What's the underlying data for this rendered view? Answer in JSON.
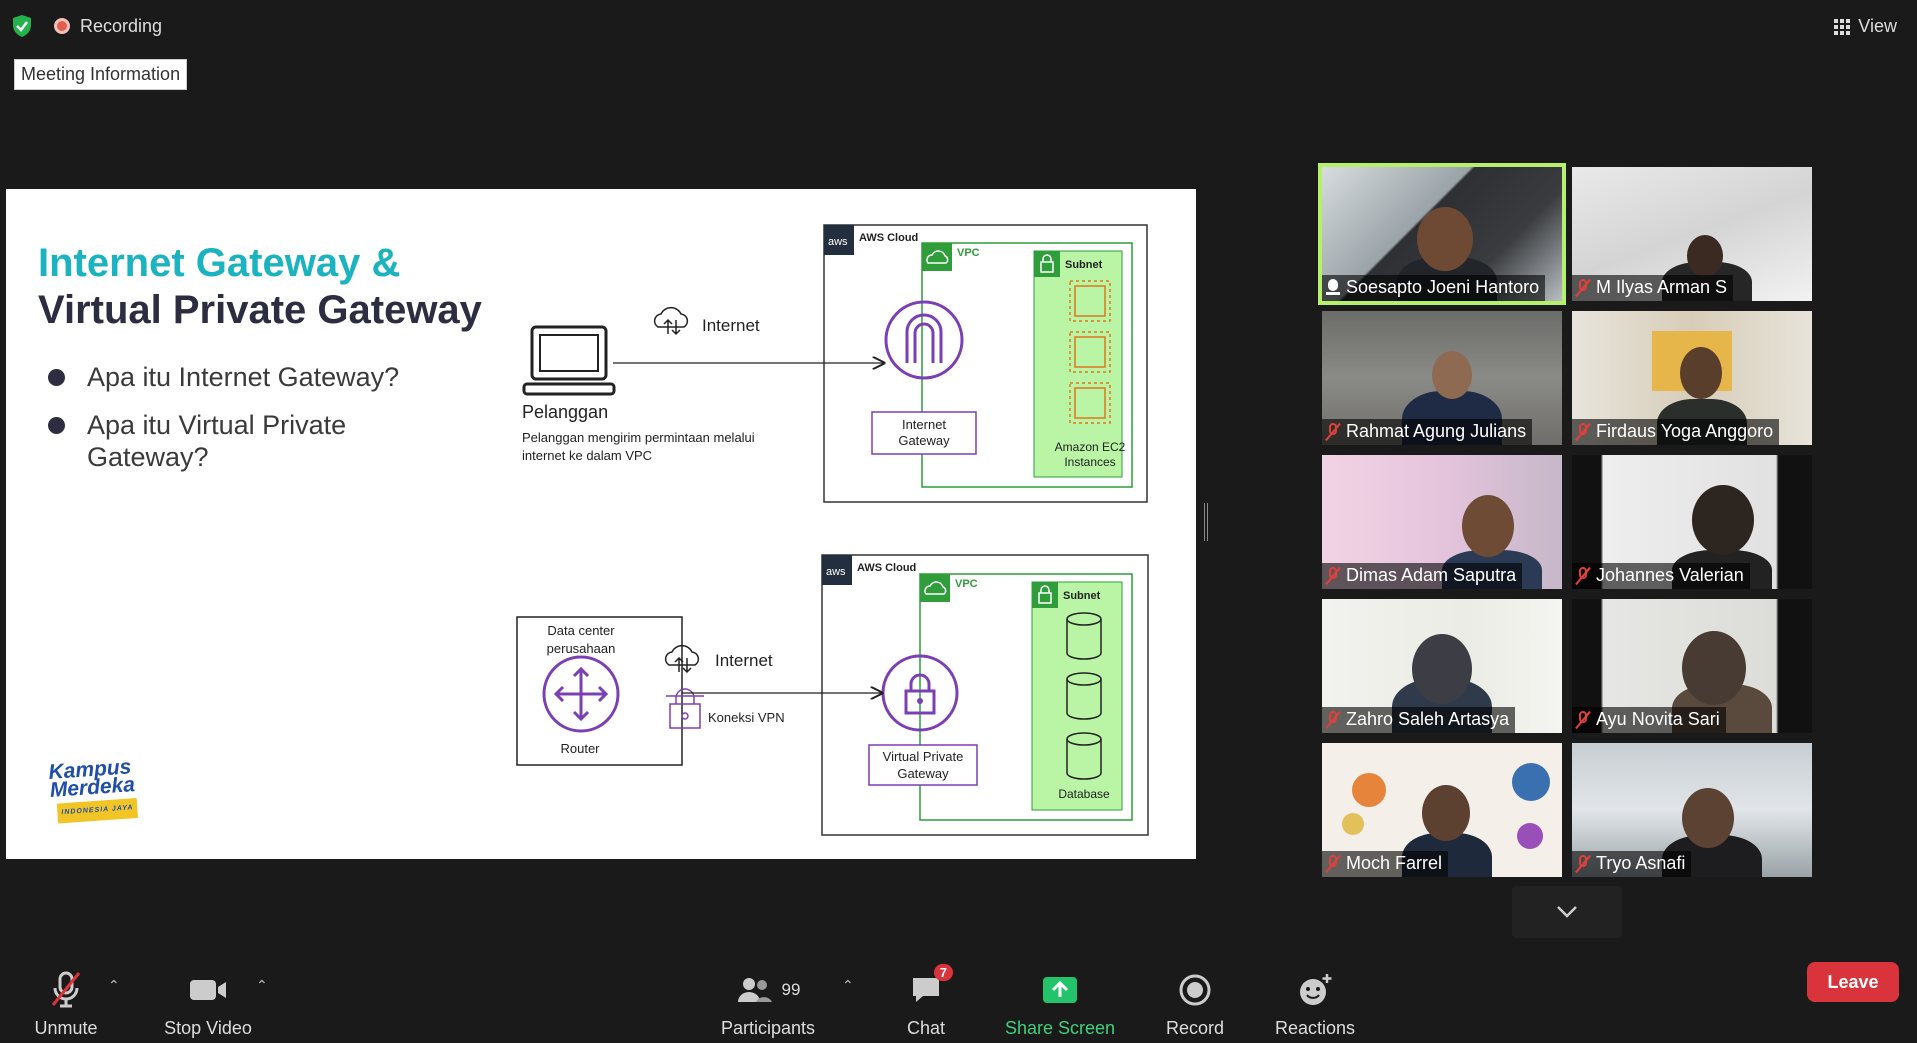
{
  "top": {
    "recording_label": "Recording",
    "meeting_info_label": "Meeting Information",
    "view_label": "View"
  },
  "slide": {
    "title_line1": "Internet Gateway &",
    "title_line2": "Virtual Private Gateway",
    "bullets": [
      "Apa itu Internet Gateway?",
      "Apa itu Virtual Private Gateway?"
    ],
    "top_diagram": {
      "aws_logo": "aws",
      "cloud_label": "AWS Cloud",
      "vpc_label": "VPC",
      "subnet_label": "Subnet",
      "internet_label": "Internet",
      "customer_label": "Pelanggan",
      "customer_desc_line1": "Pelanggan mengirim permintaan melalui",
      "customer_desc_line2": "internet ke dalam VPC",
      "gateway_line1": "Internet",
      "gateway_line2": "Gateway",
      "ec2_line1": "Amazon EC2",
      "ec2_line2": "Instances"
    },
    "bottom_diagram": {
      "aws_logo": "aws",
      "cloud_label": "AWS Cloud",
      "vpc_label": "VPC",
      "subnet_label": "Subnet",
      "datacenter_line1": "Data center",
      "datacenter_line2": "perusahaan",
      "router_label": "Router",
      "internet_label": "Internet",
      "vpn_label": "Koneksi VPN",
      "vpg_line1": "Virtual Private",
      "vpg_line2": "Gateway",
      "database_label": "Database"
    },
    "logo_line1": "Kampus",
    "logo_line2": "Merdeka",
    "logo_sub": "INDONESIA JAYA"
  },
  "participants": [
    {
      "name": "Soesapto Joeni Hantoro",
      "muted": false,
      "active": true
    },
    {
      "name": "M Ilyas Arman S",
      "muted": true
    },
    {
      "name": "Rahmat Agung Julians",
      "muted": true
    },
    {
      "name": "Firdaus Yoga Anggoro",
      "muted": true
    },
    {
      "name": "Dimas Adam Saputra",
      "muted": true
    },
    {
      "name": "Johannes Valerian",
      "muted": true
    },
    {
      "name": "Zahro Saleh Artasya",
      "muted": true
    },
    {
      "name": "Ayu Novita Sari",
      "muted": true
    },
    {
      "name": "Moch Farrel",
      "muted": true
    },
    {
      "name": "Tryo Asnafi",
      "muted": true
    }
  ],
  "toolbar": {
    "unmute_label": "Unmute",
    "stop_video_label": "Stop Video",
    "participants_label": "Participants",
    "participants_count": "99",
    "chat_label": "Chat",
    "chat_badge": "7",
    "share_screen_label": "Share Screen",
    "record_label": "Record",
    "reactions_label": "Reactions",
    "leave_label": "Leave"
  },
  "colors": {
    "title_teal": "#1cb3c1",
    "title_navy": "#2d2d42",
    "aws_purple": "#7b3fb5",
    "aws_green": "#2e9d3a",
    "subnet_fill": "#b9f5a5",
    "ec2_orange": "#e0761a",
    "share_green": "#23c36a",
    "leave_red": "#d9333b",
    "active_outline": "#b6f06a"
  }
}
